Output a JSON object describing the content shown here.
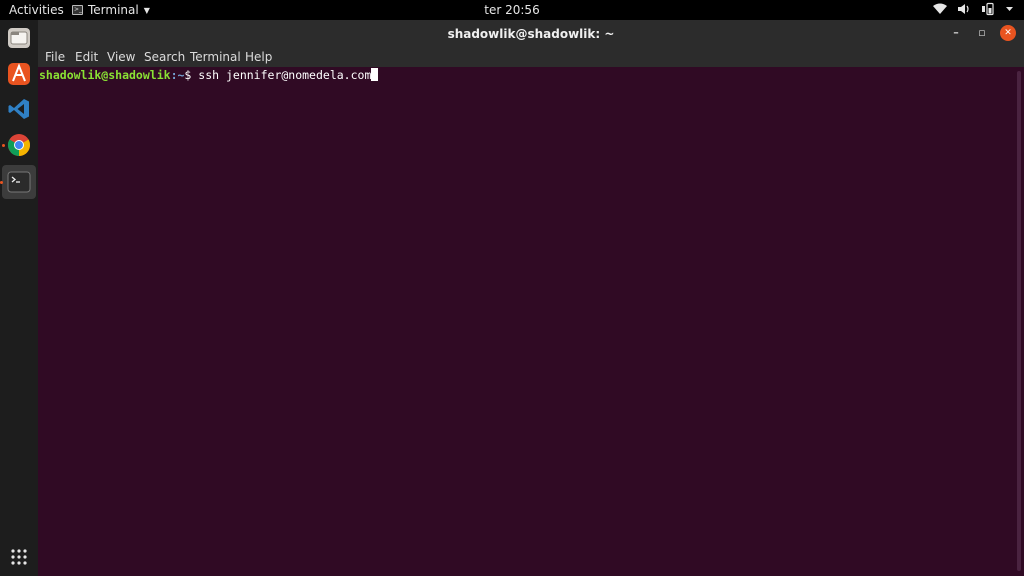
{
  "topbar": {
    "activities": "Activities",
    "app_name": "Terminal",
    "clock": "ter 20:56",
    "tray_icons": [
      "wifi-icon",
      "volume-icon",
      "battery-icon",
      "system-menu-caret-icon"
    ]
  },
  "dock": {
    "items": [
      {
        "name": "files",
        "icon": "files-icon"
      },
      {
        "name": "software",
        "icon": "software-icon"
      },
      {
        "name": "vscode",
        "icon": "vscode-icon"
      },
      {
        "name": "chrome",
        "icon": "chrome-icon",
        "running": true
      },
      {
        "name": "terminal",
        "icon": "terminal-icon",
        "running": true,
        "active": true
      }
    ],
    "show_apps_icon": "grid-icon"
  },
  "window": {
    "title": "shadowlik@shadowlik: ~",
    "menu": [
      "File",
      "Edit",
      "View",
      "Search",
      "Terminal",
      "Help"
    ]
  },
  "terminal": {
    "user_host": "shadowlik@shadowlik",
    "path": ":~",
    "prompt_symbol": "$",
    "command": " ssh jennifer@nomedela.com"
  },
  "colors": {
    "terminal_bg": "#300a24",
    "prompt_user": "#8ae234",
    "prompt_path": "#729fcf",
    "accent": "#e95420"
  }
}
